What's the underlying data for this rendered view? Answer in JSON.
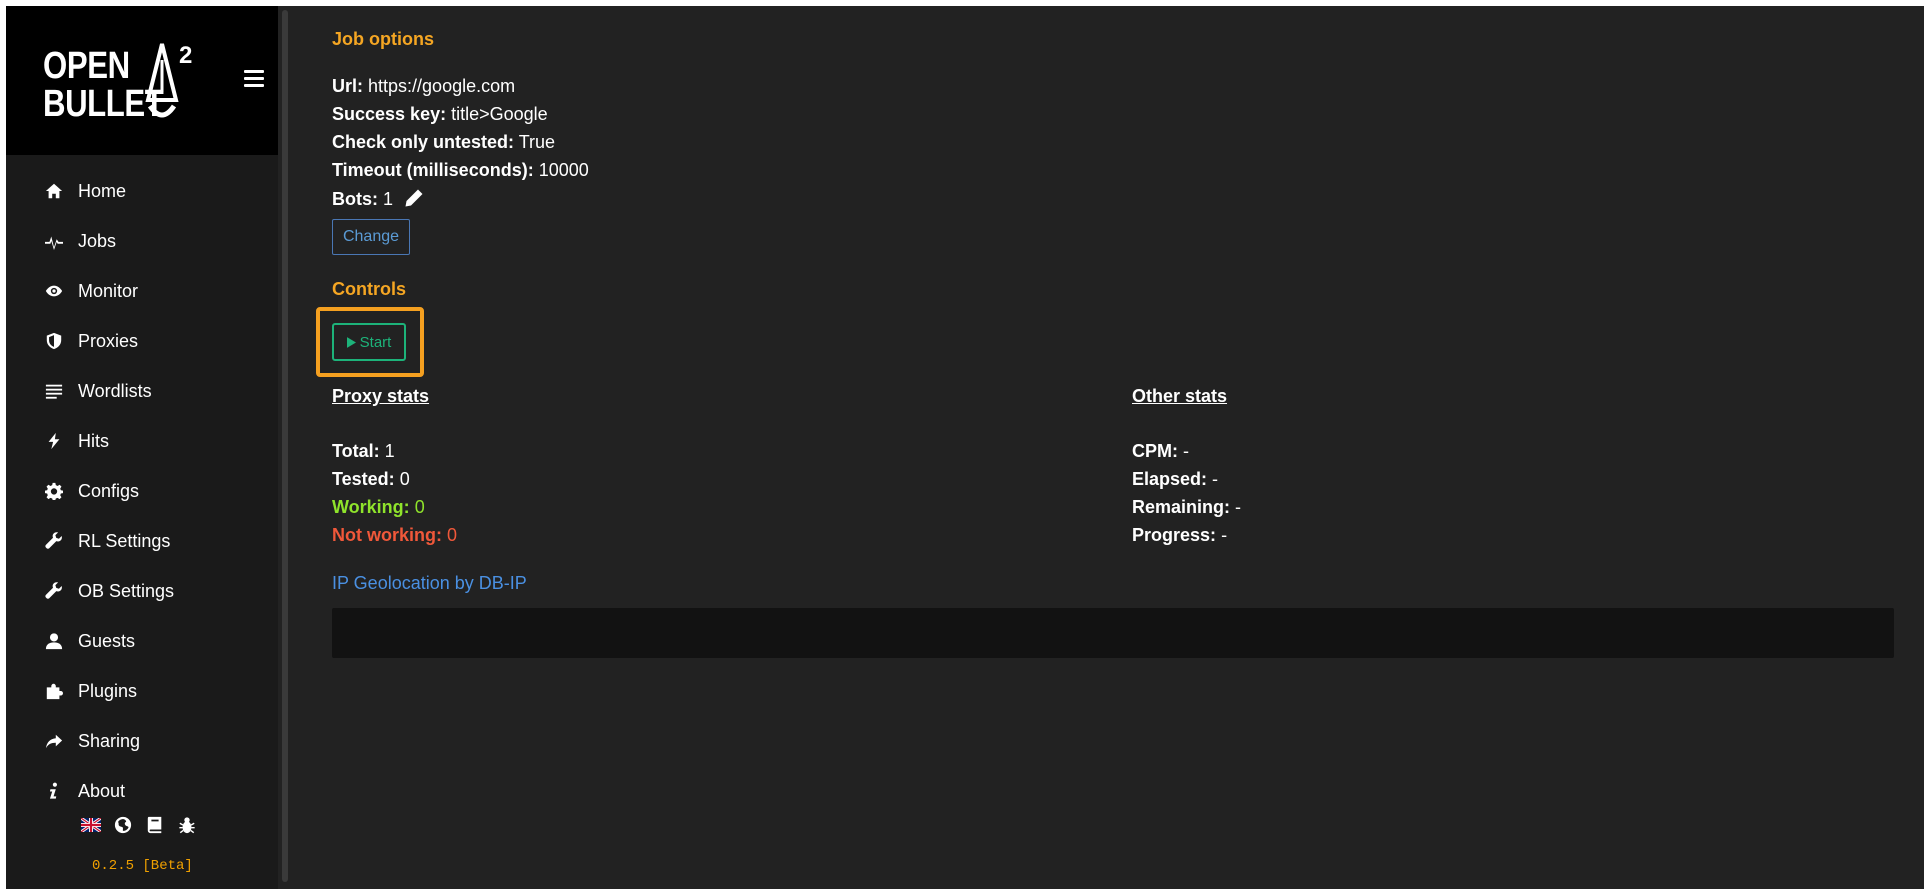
{
  "logo": {
    "line1": "OPEN",
    "line2": "BULLET",
    "sup": "2"
  },
  "nav": [
    {
      "label": "Home",
      "icon": "home-icon"
    },
    {
      "label": "Jobs",
      "icon": "pulse-icon"
    },
    {
      "label": "Monitor",
      "icon": "eye-icon"
    },
    {
      "label": "Proxies",
      "icon": "shield-icon"
    },
    {
      "label": "Wordlists",
      "icon": "list-icon"
    },
    {
      "label": "Hits",
      "icon": "bolt-icon"
    },
    {
      "label": "Configs",
      "icon": "gear-icon"
    },
    {
      "label": "RL Settings",
      "icon": "wrench-icon"
    },
    {
      "label": "OB Settings",
      "icon": "wrench-icon"
    },
    {
      "label": "Guests",
      "icon": "user-icon"
    },
    {
      "label": "Plugins",
      "icon": "puzzle-icon"
    },
    {
      "label": "Sharing",
      "icon": "share-icon"
    },
    {
      "label": "About",
      "icon": "info-icon"
    }
  ],
  "footer": {
    "icons": [
      "uk-flag-icon",
      "globe-icon",
      "book-icon",
      "bug-icon"
    ],
    "version": "0.2.5 [Beta]"
  },
  "job_options": {
    "title": "Job options",
    "url_label": "Url:",
    "url_value": "https://google.com",
    "success_key_label": "Success key:",
    "success_key_value": "title>Google",
    "check_untested_label": "Check only untested:",
    "check_untested_value": "True",
    "timeout_label": "Timeout (milliseconds):",
    "timeout_value": "10000",
    "bots_label": "Bots:",
    "bots_value": "1",
    "change_button": "Change"
  },
  "controls": {
    "title": "Controls",
    "start_button": "Start",
    "highlight_color": "#f5a020"
  },
  "proxy_stats": {
    "title": "Proxy stats",
    "total_label": "Total:",
    "total_value": "1",
    "tested_label": "Tested:",
    "tested_value": "0",
    "working_label": "Working:",
    "working_value": "0",
    "not_working_label": "Not working:",
    "not_working_value": "0"
  },
  "other_stats": {
    "title": "Other stats",
    "cpm_label": "CPM:",
    "cpm_value": "-",
    "elapsed_label": "Elapsed:",
    "elapsed_value": "-",
    "remaining_label": "Remaining:",
    "remaining_value": "-",
    "progress_label": "Progress:",
    "progress_value": "-"
  },
  "geolocation": {
    "link": "IP Geolocation by DB-IP"
  },
  "colors": {
    "accent": "#f5a623",
    "start_green": "#1db37a",
    "working_green": "#8fe32b",
    "not_working_red": "#f0583a",
    "link_blue": "#4a90e2"
  }
}
